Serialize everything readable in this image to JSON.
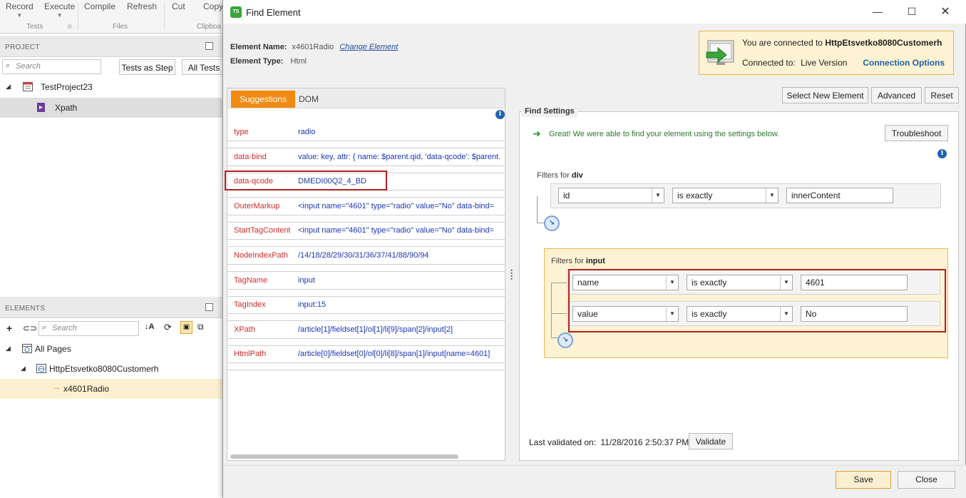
{
  "ribbon": {
    "buttons": [
      {
        "label": "Record"
      },
      {
        "label": "Execute"
      },
      {
        "label": "Compile"
      },
      {
        "label": "Refresh"
      },
      {
        "label": "Cut"
      },
      {
        "label": "Copy"
      }
    ],
    "groups": [
      "Tests",
      "Files",
      "Clipboa"
    ]
  },
  "project_panel": {
    "header": "PROJECT",
    "search_placeholder": "Search",
    "tests_as_step": "Tests as Step",
    "all_tests": "All Tests",
    "tree": [
      {
        "label": "TestProject23",
        "icon": "project-icon"
      },
      {
        "label": "Xpath",
        "icon": "test-icon"
      }
    ]
  },
  "elements_panel": {
    "header": "ELEMENTS",
    "search_placeholder": "Search",
    "tree": [
      {
        "label": "All Pages"
      },
      {
        "label": "HttpEtsvetko8080Customerh"
      },
      {
        "label": "x4601Radio"
      }
    ]
  },
  "dialog": {
    "title": "Find Element",
    "element_name_label": "Element Name:",
    "element_name": "x4601Radio",
    "change_element": "Change Element",
    "element_type_label": "Element Type:",
    "element_type": "Html",
    "connection": {
      "prefix": "You are connected to",
      "target": "HttpEtsvetko8080Customerh",
      "connected_to_label": "Connected to:",
      "version": "Live Version",
      "options": "Connection Options"
    },
    "tabs": [
      "Suggestions",
      "DOM"
    ],
    "suggestions": [
      {
        "key": "type",
        "value": "radio"
      },
      {
        "key": "data-bind",
        "value": "value: key, attr: { name: $parent.qid, 'data-qcode': $parent."
      },
      {
        "key": "data-qcode",
        "value": "DMEDI00Q2_4_BD"
      },
      {
        "key": "OuterMarkup",
        "value": "<input name=\"4601\" type=\"radio\" value=\"No\" data-bind="
      },
      {
        "key": "StartTagContent",
        "value": "<input name=\"4601\" type=\"radio\" value=\"No\" data-bind="
      },
      {
        "key": "NodeIndexPath",
        "value": "/14/18/28/29/30/31/36/37/41/88/90/94"
      },
      {
        "key": "TagName",
        "value": "input"
      },
      {
        "key": "TagIndex",
        "value": "input:15"
      },
      {
        "key": "XPath",
        "value": "/article[1]/fieldset[1]/ol[1]/li[9]/span[2]/input[2]"
      },
      {
        "key": "HtmlPath",
        "value": "/article[0]/fieldset[0]/ol[0]/li[8]/span[1]/input[name=4601]"
      }
    ],
    "top_buttons": [
      "Select New Element",
      "Advanced",
      "Reset"
    ],
    "find_settings": {
      "title": "Find Settings",
      "message": "Great! We were able to find your element using the settings below.",
      "troubleshoot": "Troubleshoot",
      "div_filters_prefix": "Filters for",
      "div_tag": "div",
      "div_filters": [
        {
          "attribute": "id",
          "operator": "is exactly",
          "value": "innerContent"
        }
      ],
      "input_filters_prefix": "Filters for",
      "input_tag": "input",
      "input_filters": [
        {
          "attribute": "name",
          "operator": "is exactly",
          "value": "4601"
        },
        {
          "attribute": "value",
          "operator": "is exactly",
          "value": "No"
        }
      ],
      "last_validated_label": "Last validated on:",
      "last_validated": "11/28/2016 2:50:37 PM",
      "validate": "Validate"
    },
    "save": "Save",
    "close": "Close",
    "colors": {
      "accent": "#f08a11",
      "key_red": "#d12a2a",
      "value_blue": "#1b37b5",
      "highlight": "#b41e1e"
    }
  }
}
